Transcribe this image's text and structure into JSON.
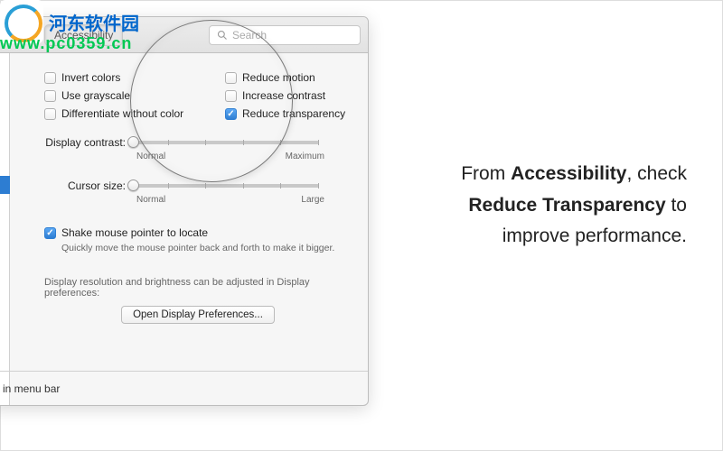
{
  "watermark": {
    "brand": "河东软件园",
    "url": "www.pc0359.cn"
  },
  "toolbar": {
    "tab_label": "Accessibility",
    "search_placeholder": "Search"
  },
  "checks_left": [
    {
      "label": "Invert colors",
      "checked": false
    },
    {
      "label": "Use grayscale",
      "checked": false
    },
    {
      "label": "Differentiate without color",
      "checked": false
    }
  ],
  "checks_right": [
    {
      "label": "Reduce motion",
      "checked": false
    },
    {
      "label": "Increase contrast",
      "checked": false
    },
    {
      "label": "Reduce transparency",
      "checked": true
    }
  ],
  "sliders": {
    "contrast": {
      "label": "Display contrast:",
      "min_label": "Normal",
      "max_label": "Maximum"
    },
    "cursor": {
      "label": "Cursor size:",
      "min_label": "Normal",
      "max_label": "Large"
    }
  },
  "shake": {
    "label": "Shake mouse pointer to locate",
    "checked": true,
    "help": "Quickly move the mouse pointer back and forth to make it bigger."
  },
  "display_section": {
    "hint": "Display resolution and brightness can be adjusted in Display preferences:",
    "button": "Open Display Preferences..."
  },
  "footer": {
    "menubar_label": "in menu bar"
  },
  "instruction": {
    "t1": "From ",
    "b1": "Accessibility",
    "t2": ", check",
    "b2": "Reduce Transparency",
    "t3": " to",
    "t4": "improve performance."
  }
}
